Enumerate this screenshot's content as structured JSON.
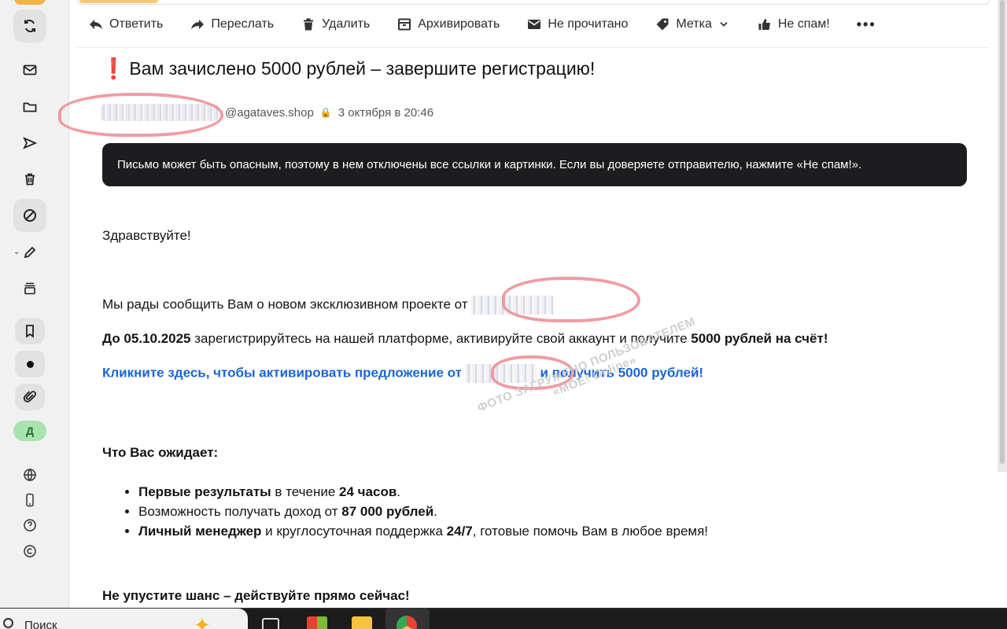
{
  "toolbar": {
    "reply": "Ответить",
    "forward": "Переслать",
    "delete": "Удалить",
    "archive": "Архивировать",
    "unread": "Не прочитано",
    "label": "Метка",
    "not_spam": "Не спам!",
    "more": "•••"
  },
  "message": {
    "subject": "Вам зачислено 5000 рублей – завершите регистрацию!",
    "sender_domain": "@agataves.shop",
    "date": "3 октября в 20:46",
    "warning": "Письмо может быть опасным, поэтому в нем отключены все ссылки и картинки. Если вы доверяете отправителю, нажмите «Не спам!».",
    "greeting": "Здравствуйте!",
    "intro": "Мы рады сообщить Вам о новом эксклюзивном проекте от",
    "deadline_bold": "До 05.10.2025",
    "deadline_text": " зарегистрируйтесь на нашей платформе, активируйте свой аккаунт и получите ",
    "deadline_amount": "5000 рублей на счёт!",
    "link_part1": "Кликните здесь, чтобы активировать предложение от",
    "link_part2": "и получить 5000 рублей!",
    "expect_title": "Что Вас ожидает:",
    "list": [
      {
        "b1": "Первые результаты",
        "t1": " в течение ",
        "b2": "24 часов",
        "t2": "."
      },
      {
        "b1": "",
        "t1": "Возможность получать доход от ",
        "b2": "87 000 рублей",
        "t2": "."
      },
      {
        "b1": "Личный менеджер",
        "t1": " и круглосуточная поддержка ",
        "b2": "24/7",
        "t2": ", готовые помочь Вам в любое время!"
      }
    ],
    "closing": "Не упустите шанс – действуйте прямо сейчас!"
  },
  "watermark": {
    "line1": "ФОТО ЗАГРУЖЕНО ПОЛЬЗОВАТЕЛЕМ",
    "line2": "«МОЁ! Online»"
  },
  "sidebar": {
    "avatar_letter": "Д",
    "icons": [
      "refresh-icon",
      "mail-icon",
      "folder-icon",
      "send-icon",
      "trash-icon",
      "spam-icon",
      "pencil-icon",
      "archive-icon",
      "bookmark-icon",
      "dot-icon",
      "attachment-icon",
      "globe-icon",
      "phone-icon",
      "help-icon",
      "copyright-icon"
    ]
  },
  "taskbar": {
    "search_label": "Поиск"
  },
  "colors": {
    "link": "#1a64d6",
    "banner": "#1d1d1f",
    "avatar_bg": "#a8e3b0",
    "redaction": "#f08a92"
  }
}
